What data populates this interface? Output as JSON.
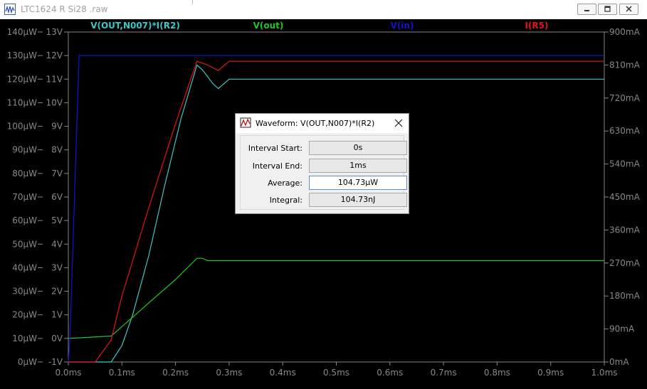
{
  "window": {
    "title": "LTC1624 R Si28 .raw"
  },
  "plot": {
    "background": "#000000",
    "axis_color": "#888888",
    "traces": [
      {
        "label": "V(OUT,N007)*I(R2)",
        "color": "#3cc8c8"
      },
      {
        "label": "V(out)",
        "color": "#1ec81e"
      },
      {
        "label": "V(in)",
        "color": "#1414d2"
      },
      {
        "label": "I(R5)",
        "color": "#e61414"
      }
    ],
    "y_left_power_ticks": [
      "140µW",
      "130µW",
      "120µW",
      "110µW",
      "100µW",
      "90µW",
      "80µW",
      "70µW",
      "60µW",
      "50µW",
      "40µW",
      "30µW",
      "20µW",
      "10µW",
      "0µW"
    ],
    "y_left_volt_ticks": [
      "13V",
      "12V",
      "11V",
      "10V",
      "9V",
      "8V",
      "7V",
      "6V",
      "5V",
      "4V",
      "3V",
      "2V",
      "1V",
      "0V",
      "-1V"
    ],
    "y_right_ticks": [
      "900mA",
      "810mA",
      "720mA",
      "630mA",
      "540mA",
      "450mA",
      "360mA",
      "270mA",
      "180mA",
      "90mA",
      "0mA"
    ],
    "x_ticks": [
      "0.0ms",
      "0.1ms",
      "0.2ms",
      "0.3ms",
      "0.4ms",
      "0.5ms",
      "0.6ms",
      "0.7ms",
      "0.8ms",
      "0.9ms",
      "1.0ms"
    ]
  },
  "chart_data": {
    "type": "line",
    "x_unit": "ms",
    "xlim": [
      0,
      1.0
    ],
    "axes": {
      "left_power_uW": [
        0,
        140
      ],
      "left_voltage_V": [
        -1,
        13
      ],
      "right_current_mA": [
        0,
        900
      ]
    },
    "series": [
      {
        "name": "V(OUT,N007)*I(R2)",
        "axis": "left_power_uW",
        "x": [
          0,
          0.05,
          0.08,
          0.1,
          0.12,
          0.15,
          0.18,
          0.21,
          0.24,
          0.25,
          0.27,
          0.28,
          0.3,
          1.0
        ],
        "y": [
          0,
          0,
          0,
          7,
          20,
          45,
          75,
          103,
          126,
          124,
          118,
          116,
          120,
          120
        ]
      },
      {
        "name": "V(out)",
        "axis": "left_voltage_V",
        "x": [
          0,
          0.08,
          0.1,
          0.15,
          0.2,
          0.24,
          0.25,
          0.26,
          0.28,
          0.3,
          1.0
        ],
        "y": [
          0,
          0.1,
          0.5,
          1.5,
          2.5,
          3.4,
          3.4,
          3.3,
          3.3,
          3.3,
          3.3
        ]
      },
      {
        "name": "V(in)",
        "axis": "left_voltage_V",
        "x": [
          0,
          0.003,
          0.02,
          0.25,
          0.3,
          1.0
        ],
        "y": [
          -1,
          0,
          12,
          12,
          12,
          12
        ]
      },
      {
        "name": "I(R5)",
        "axis": "right_current_mA",
        "x": [
          0,
          0.05,
          0.08,
          0.1,
          0.15,
          0.2,
          0.24,
          0.26,
          0.28,
          0.3,
          1.0
        ],
        "y": [
          0,
          0,
          60,
          180,
          420,
          650,
          820,
          810,
          795,
          820,
          820
        ]
      }
    ]
  },
  "dialog": {
    "title": "Waveform: V(OUT,N007)*I(R2)",
    "rows": [
      {
        "label": "Interval Start:",
        "value": "0s"
      },
      {
        "label": "Interval End:",
        "value": "1ms"
      },
      {
        "label": "Average:",
        "value": "104.73µW"
      },
      {
        "label": "Integral:",
        "value": "104.73nJ"
      }
    ]
  }
}
